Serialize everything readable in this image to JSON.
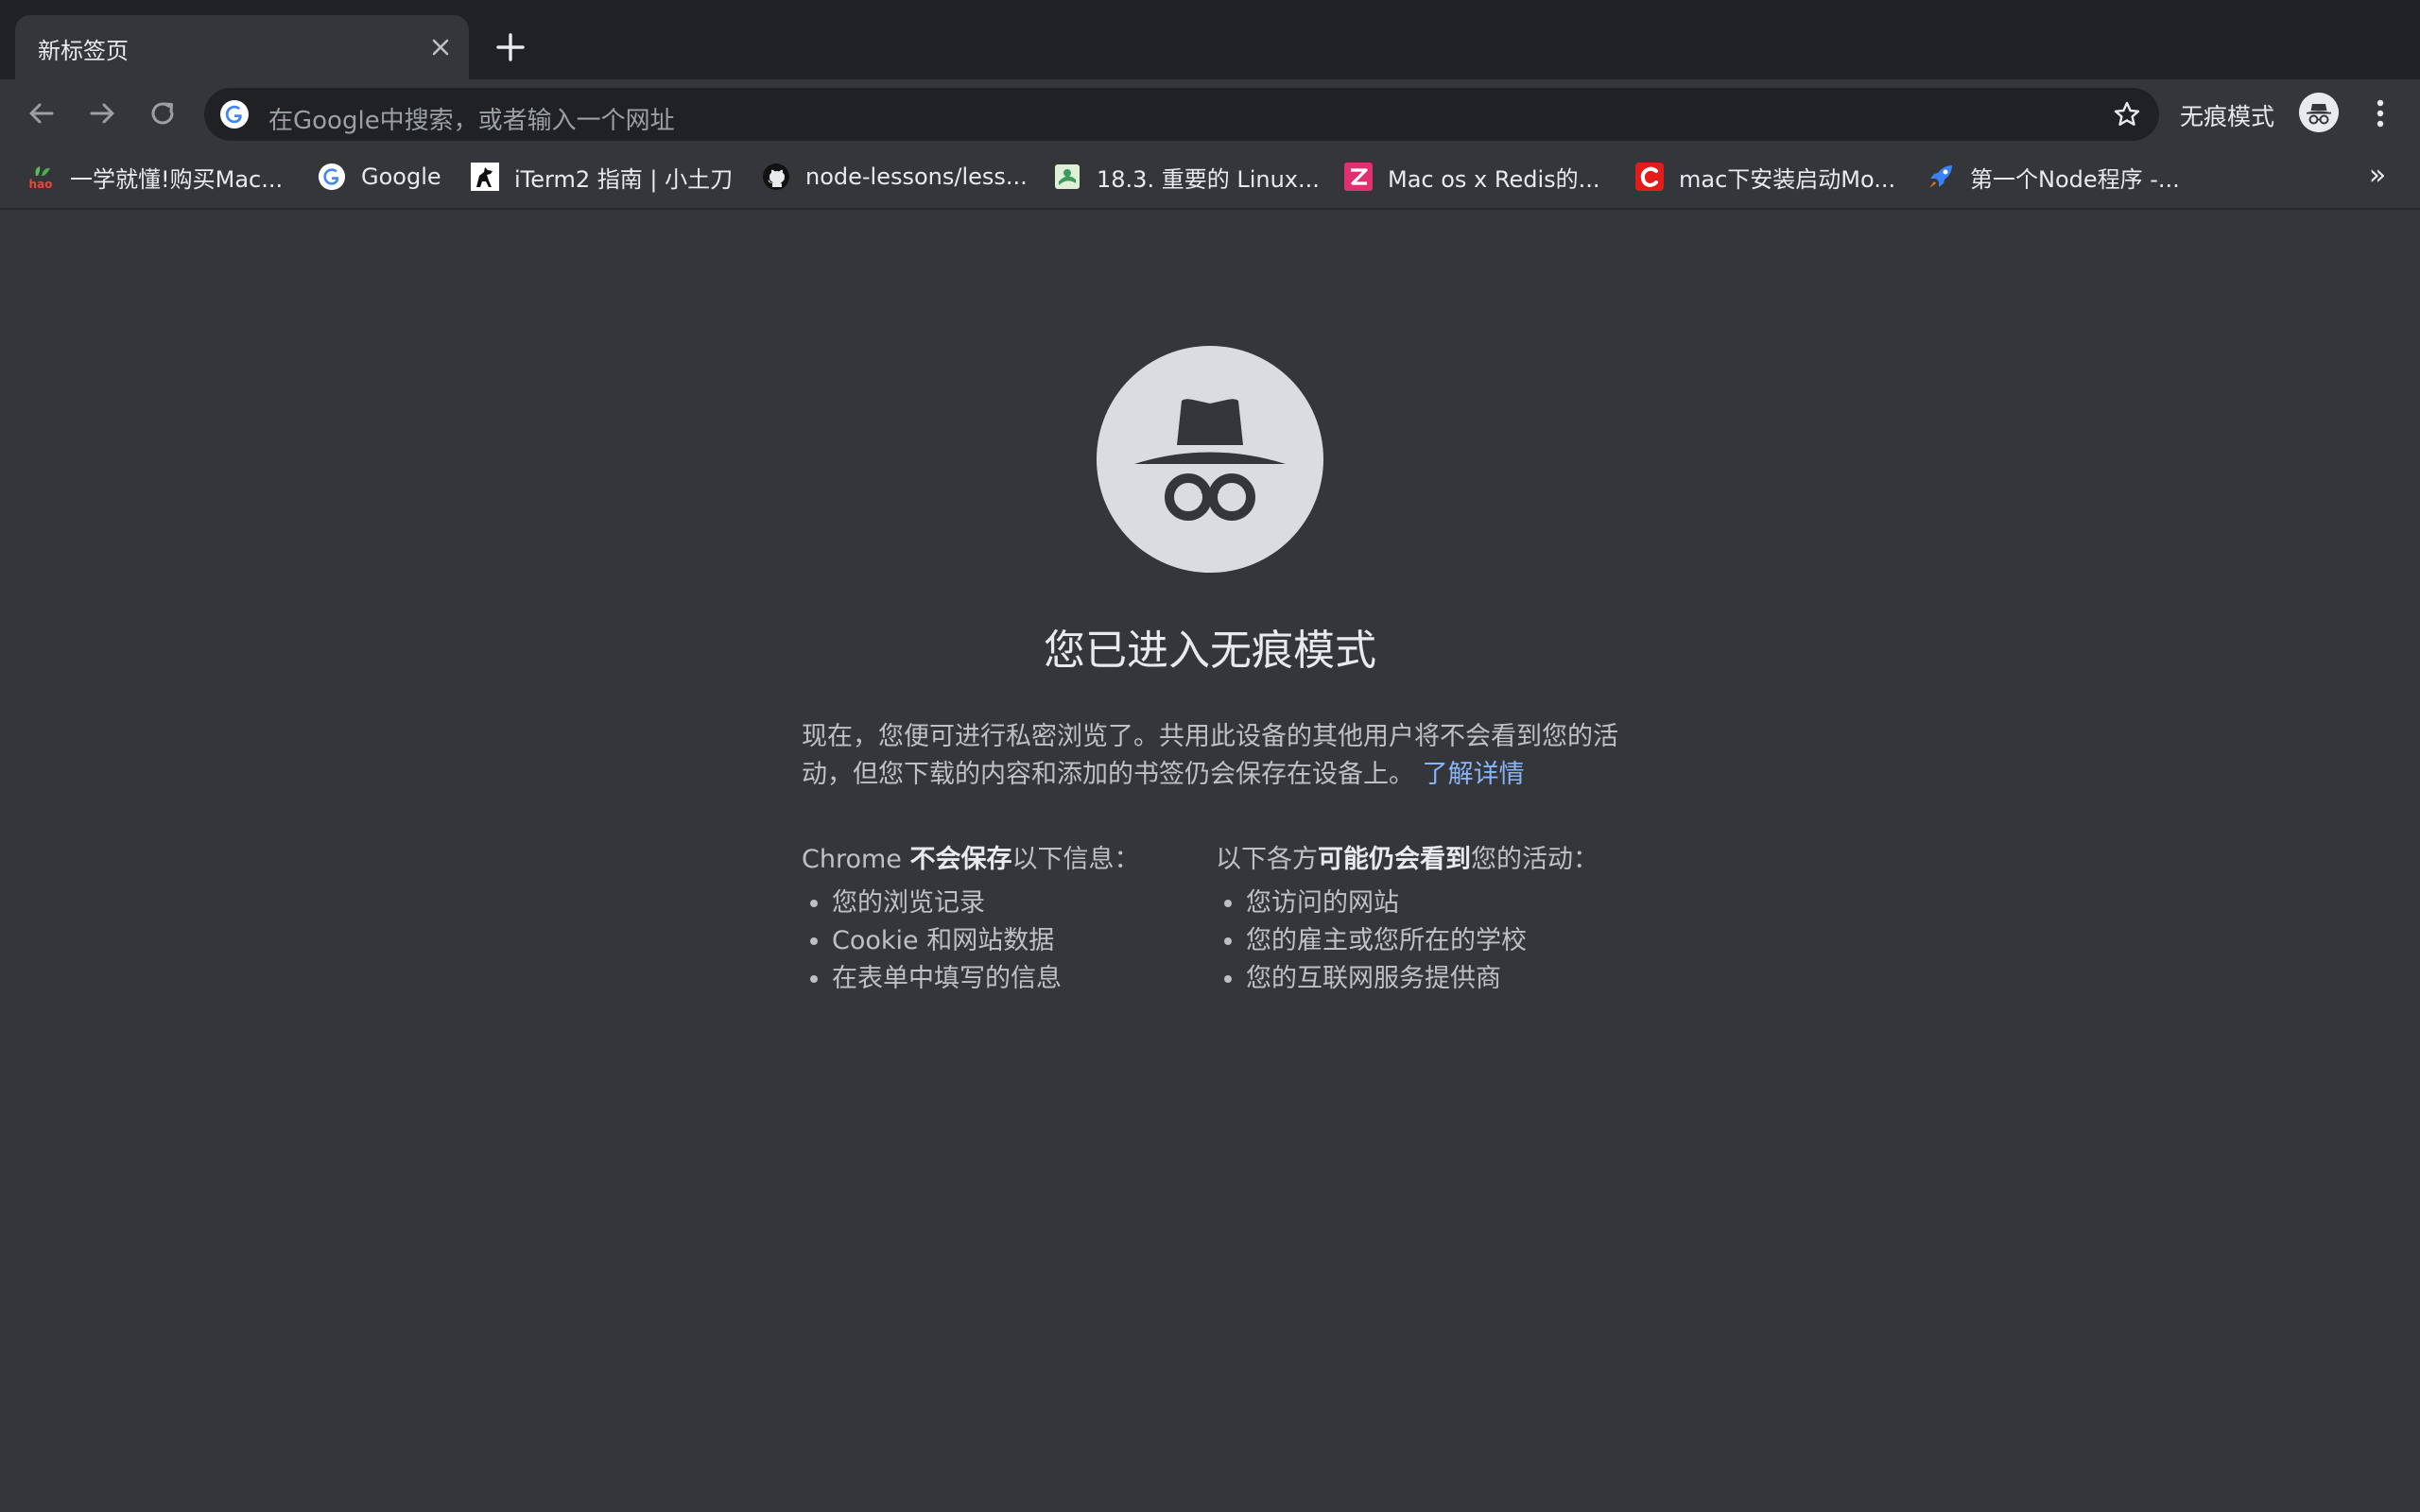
{
  "tabs": [
    {
      "title": "新标签页",
      "active": true
    }
  ],
  "omnibox": {
    "placeholder": "在Google中搜索，或者输入一个网址"
  },
  "profile": {
    "label": "无痕模式"
  },
  "bookmarks": [
    {
      "label": "一学就懂!购买Mac...",
      "icon": "hao-icon"
    },
    {
      "label": "Google",
      "icon": "google-icon"
    },
    {
      "label": "iTerm2 指南 | 小土刀",
      "icon": "horse-logo-icon"
    },
    {
      "label": "node-lessons/less...",
      "icon": "github-icon"
    },
    {
      "label": "18.3. 重要的 Linux...",
      "icon": "book-icon"
    },
    {
      "label": "Mac os x Redis的...",
      "icon": "zhihu-icon"
    },
    {
      "label": "mac下安装启动Mo...",
      "icon": "csdn-icon"
    },
    {
      "label": "第一个Node程序 -...",
      "icon": "rocket-icon"
    }
  ],
  "bookmarks_overflow": "»",
  "content": {
    "heading": "您已进入无痕模式",
    "description": "现在，您便可进行私密浏览了。共用此设备的其他用户将不会看到您的活动，但您下载的内容和添加的书签仍会保存在设备上。",
    "learn_more": "了解详情",
    "left_column": {
      "prefix": "Chrome ",
      "strong": "不会保存",
      "suffix": "以下信息：",
      "items": [
        "您的浏览记录",
        "Cookie 和网站数据",
        "在表单中填写的信息"
      ]
    },
    "right_column": {
      "prefix": "以下各方",
      "strong": "可能仍会看到",
      "suffix": "您的活动：",
      "items": [
        "您访问的网站",
        "您的雇主或您所在的学校",
        "您的互联网服务提供商"
      ]
    }
  },
  "colors": {
    "page_bg": "#35363a",
    "frame_bg": "#202124",
    "text": "#e8eaed",
    "secondary_text": "#bdc1c6",
    "link": "#8ab4f8"
  }
}
